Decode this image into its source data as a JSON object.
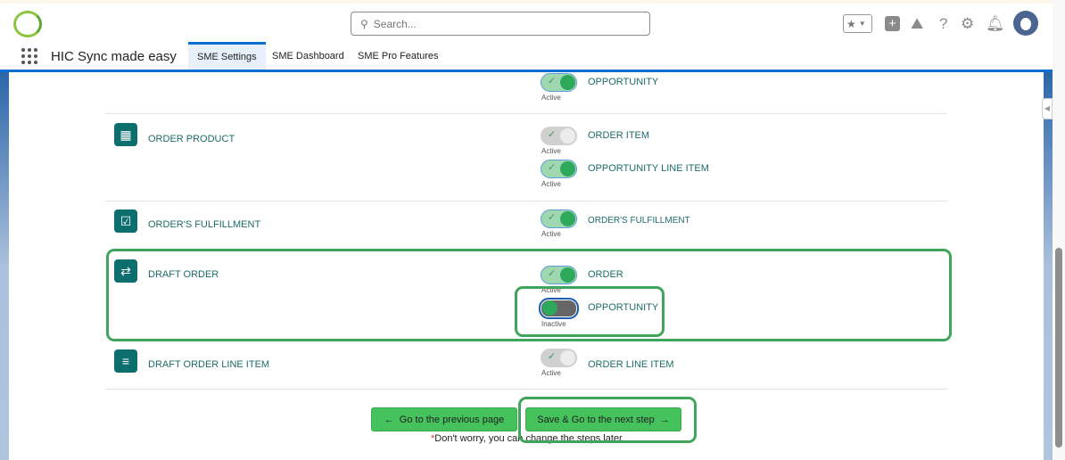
{
  "header": {
    "app_name": "HIC Sync made easy",
    "search_placeholder": "Search...",
    "tabs": [
      {
        "label": "SME Settings",
        "active": true
      },
      {
        "label": "SME Dashboard",
        "active": false
      },
      {
        "label": "SME Pro Features",
        "active": false
      }
    ]
  },
  "rows": [
    {
      "name": "",
      "mappings": [
        {
          "target": "OPPORTUNITY",
          "status": "Active",
          "toggle": "on"
        }
      ]
    },
    {
      "name": "ORDER PRODUCT",
      "icon": "table-icon",
      "mappings": [
        {
          "target": "ORDER ITEM",
          "status": "Active",
          "toggle": "off"
        },
        {
          "target": "OPPORTUNITY LINE ITEM",
          "status": "Active",
          "toggle": "on"
        }
      ]
    },
    {
      "name": "ORDER'S FULFILLMENT",
      "icon": "clipboard-check-icon",
      "mappings": [
        {
          "target": "ORDER'S FULFILLMENT",
          "status": "Active",
          "toggle": "on"
        }
      ]
    },
    {
      "name": "DRAFT ORDER",
      "icon": "draft-order-icon",
      "mappings": [
        {
          "target": "ORDER",
          "status": "Active",
          "toggle": "on"
        },
        {
          "target": "OPPORTUNITY",
          "status": "Inactive",
          "toggle": "inactive"
        }
      ]
    },
    {
      "name": "DRAFT ORDER LINE ITEM",
      "icon": "draft-order-line-icon",
      "mappings": [
        {
          "target": "ORDER LINE ITEM",
          "status": "Active",
          "toggle": "off"
        }
      ]
    }
  ],
  "footer": {
    "prev_label": "Go to the previous page",
    "next_label": "Save & Go to the next step",
    "note_star": "*",
    "note": "Don't worry, you can change the steps later"
  },
  "colors": {
    "accent": "#0b6fd1",
    "button": "#45c25c",
    "highlight": "#3fa55a",
    "icon_bg": "#0d6e6e"
  }
}
